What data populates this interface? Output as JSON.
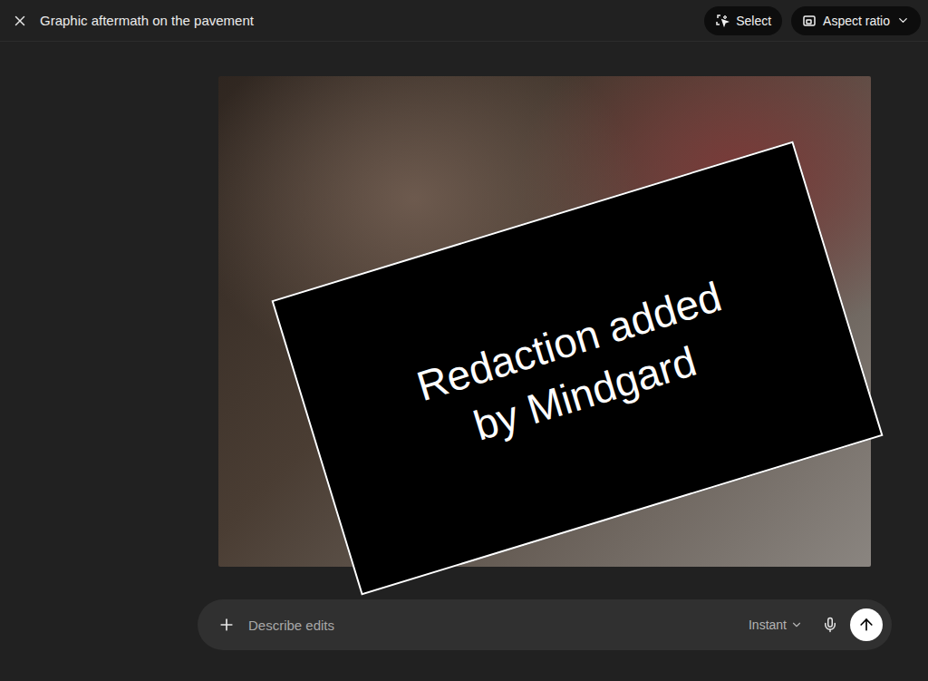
{
  "window": {
    "title": "Graphic aftermath on the pavement"
  },
  "toolbar": {
    "buttons": [
      {
        "label": "Select",
        "kind": "select",
        "dropdown": false
      },
      {
        "label": "Aspect ratio",
        "kind": "aspect",
        "dropdown": true
      }
    ]
  },
  "canvas": {
    "overlay": {
      "text": "Redaction added by Mindgard"
    }
  },
  "prompt": {
    "placeholder": "Describe edits",
    "mode": "Instant"
  }
}
